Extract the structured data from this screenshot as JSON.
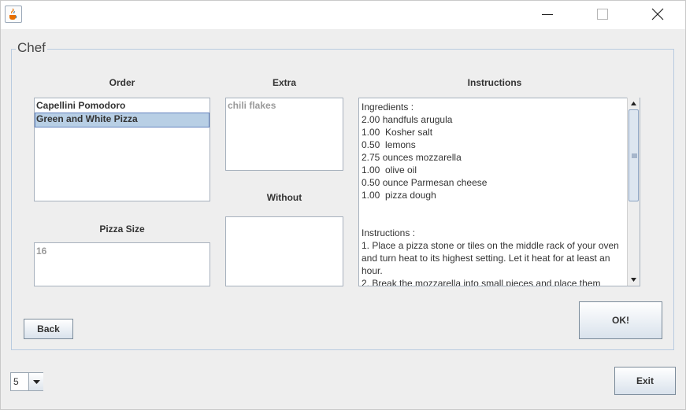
{
  "window": {
    "title": ""
  },
  "panel": {
    "title": "Chef"
  },
  "order": {
    "heading": "Order",
    "items": [
      "Capellini Pomodoro",
      "Green and White Pizza"
    ],
    "selected_index": 1
  },
  "extra": {
    "heading": "Extra",
    "items": [
      "chili flakes"
    ]
  },
  "without": {
    "heading": "Without",
    "items": []
  },
  "pizza_size": {
    "heading": "Pizza Size",
    "value": "16"
  },
  "instructions": {
    "heading": "Instructions",
    "text": "Ingredients :\n2.00 handfuls arugula\n1.00  Kosher salt\n0.50  lemons\n2.75 ounces mozzarella\n1.00  olive oil\n0.50 ounce Parmesan cheese\n1.00  pizza dough\n\n\nInstructions :\n1. Place a pizza stone or tiles on the middle rack of your oven and turn heat to its highest setting. Let it heat for at least an hour.\n2. Break the mozzarella into small pieces and place them"
  },
  "buttons": {
    "back": "Back",
    "ok": "OK!",
    "exit": "Exit"
  },
  "combo": {
    "value": "5"
  },
  "icons": {
    "app": "java-cup-icon",
    "minimize": "minimize-icon",
    "maximize": "maximize-icon",
    "close": "close-icon",
    "scroll_up": "arrow-up-icon",
    "scroll_down": "arrow-down-icon",
    "combo": "chevron-down-icon"
  },
  "colors": {
    "selection": "#b8cfe5",
    "panel_border": "#b9cbe0",
    "background": "#eeeeee"
  }
}
